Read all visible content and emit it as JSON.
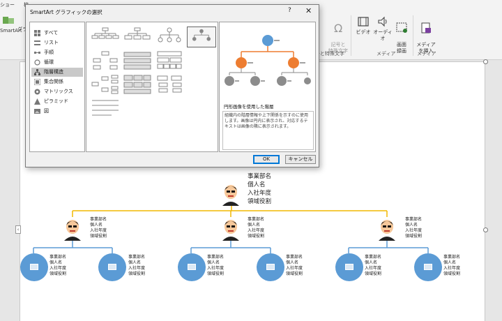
{
  "ribbon": {
    "tab_left": "ショー",
    "tab_left2": "校",
    "buttons": {
      "smartart": "SmartArt",
      "graph": "グラ",
      "symbol_label": "記号と\n特殊文字",
      "video": "ビデオ",
      "audio": "オーディオ",
      "screen_record": "画面\n録画",
      "insert_media": "メディア\nを挿入"
    },
    "groups": {
      "symbols": "号と特殊文字",
      "media": "メディア",
      "media2": "メディア"
    }
  },
  "dialog": {
    "title": "SmartArt グラフィックの選択",
    "help": "?",
    "close": "✕",
    "categories": [
      {
        "label": "すべて",
        "icon": "grid-icon",
        "selected": false
      },
      {
        "label": "リスト",
        "icon": "list-icon",
        "selected": false
      },
      {
        "label": "手順",
        "icon": "process-icon",
        "selected": false
      },
      {
        "label": "循環",
        "icon": "cycle-icon",
        "selected": false
      },
      {
        "label": "階層構造",
        "icon": "hierarchy-icon",
        "selected": true
      },
      {
        "label": "集合関係",
        "icon": "relationship-icon",
        "selected": false
      },
      {
        "label": "マトリックス",
        "icon": "matrix-icon",
        "selected": false
      },
      {
        "label": "ピラミッド",
        "icon": "pyramid-icon",
        "selected": false
      },
      {
        "label": "図",
        "icon": "picture-icon",
        "selected": false
      }
    ],
    "preview_title": "円形画像を使用した階層",
    "preview_description": "組織内の階層情報や上下関係を示すのに使用します。画像は円内に表示され、対応するテキストは画像の隣に表示されます。",
    "ok": "OK",
    "cancel": "キャンセル",
    "accent_orange": "#ed7d31",
    "accent_blue": "#5b9bd5",
    "node_gray": "#8c8c8c"
  },
  "orgchart": {
    "top": {
      "lines": [
        "事業部名",
        "個人名",
        "入社年度",
        "領域役割"
      ]
    },
    "managers": [
      {
        "lines": [
          "事業部名",
          "個人名",
          "入社年度",
          "領域役割"
        ]
      },
      {
        "lines": [
          "事業部名",
          "個人名",
          "入社年度",
          "領域役割"
        ]
      },
      {
        "lines": [
          "事業部名",
          "個人名",
          "入社年度",
          "領域役割"
        ]
      }
    ],
    "members": [
      {
        "lines": [
          "事業部名",
          "個人名",
          "入社年度",
          "領域役割"
        ]
      },
      {
        "lines": [
          "事業部名",
          "個人名",
          "入社年度",
          "領域役割"
        ]
      },
      {
        "lines": [
          "事業部名",
          "個人名",
          "入社年度",
          "領域役割"
        ]
      },
      {
        "lines": [
          "事業部名",
          "個人名",
          "入社年度",
          "領域役割"
        ]
      },
      {
        "lines": [
          "事業部名",
          "個人名",
          "入社年度",
          "領域役割"
        ]
      },
      {
        "lines": [
          "事業部名",
          "個人名",
          "入社年度",
          "領域役割"
        ]
      }
    ],
    "line_color_top": "#f2b800",
    "line_color_low": "#5b9bd5"
  }
}
